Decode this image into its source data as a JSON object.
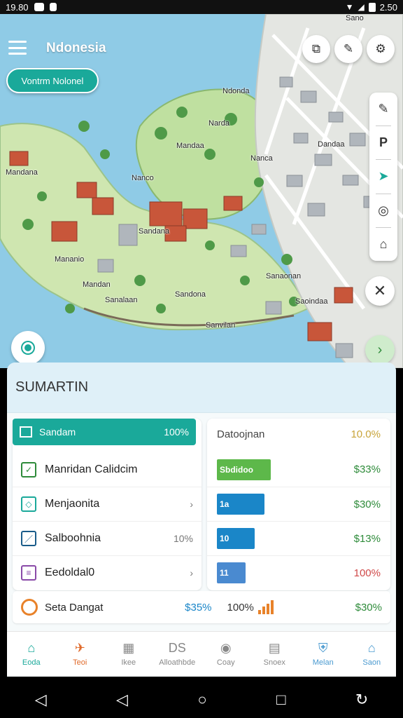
{
  "status_bar": {
    "time": "19.80",
    "right_text": "2.50"
  },
  "map": {
    "title": "Ndonesia",
    "pill_label": "Vontrm Nolonel",
    "labels": [
      "Mandana",
      "Ndonda",
      "Mandaa",
      "Nanco",
      "Mananio",
      "Sandana",
      "Nanca",
      "Dandaa",
      "Mandan",
      "Sanaonan",
      "Sandona",
      "Sanalaan",
      "Sanvilan",
      "Saoindaa",
      "Narda",
      "Sano"
    ]
  },
  "panel": {
    "header": "SUMARTIN",
    "selected": {
      "label": "Sandam",
      "value": "100%"
    },
    "left_rows": [
      {
        "label": "Manridan Calidcim",
        "extra": "",
        "color": "#2e8b3a"
      },
      {
        "label": "Menjaonita",
        "extra": "›",
        "color": "#1aa99a"
      },
      {
        "label": "Salboohnia",
        "extra": "10%",
        "color": "#1a5c8a"
      },
      {
        "label": "Eedoldal0",
        "extra": "›",
        "color": "#8a4aa8"
      }
    ],
    "right_header": {
      "label": "Datoojnan",
      "value": "10.0%"
    },
    "right_rows": [
      {
        "bar_text": "Sbdidoo",
        "value": "$33%",
        "fill": 0.85,
        "bar_color": "#5db84a",
        "value_color": "#2e8b3a"
      },
      {
        "bar_text": "1a",
        "value": "$30%",
        "fill": 0.75,
        "bar_color": "#1a86c8",
        "value_color": "#2e8b3a"
      },
      {
        "bar_text": "10",
        "value": "$13%",
        "fill": 0.6,
        "bar_color": "#1a86c8",
        "value_color": "#2e8b3a"
      },
      {
        "bar_text": "11",
        "value": "100%",
        "fill": 0.45,
        "bar_color": "#4a8ad0",
        "value_color": "#d04a4a"
      }
    ],
    "bottom": {
      "label": "Seta Dangat",
      "v1": "$35%",
      "v2": "100%",
      "v3": "$30%"
    }
  },
  "tabs": [
    {
      "label": "Eoda",
      "icon": "home-icon",
      "active": true
    },
    {
      "label": "Teoi",
      "icon": "route-icon",
      "active": false
    },
    {
      "label": "Ikee",
      "icon": "grid-icon",
      "active": false
    },
    {
      "label": "Alloathbde",
      "icon": "ds-icon",
      "active": false
    },
    {
      "label": "Coay",
      "icon": "compass-icon",
      "active": false
    },
    {
      "label": "Snoex",
      "icon": "list-icon",
      "active": false
    },
    {
      "label": "Melan",
      "icon": "shield-icon",
      "active": false
    },
    {
      "label": "Saon",
      "icon": "building-icon",
      "active": false
    }
  ],
  "colors": {
    "accent": "#1aa99a",
    "water": "#8fcbe6",
    "land": "#cfe6b0",
    "roof": "#c8563a"
  }
}
